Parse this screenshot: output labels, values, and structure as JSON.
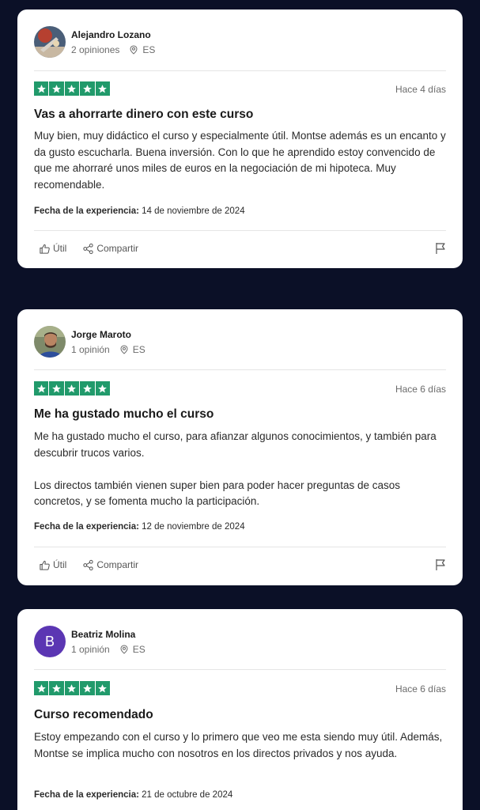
{
  "reviews": [
    {
      "reviewer": {
        "name": "Alejandro Lozano",
        "opinions": "2 opiniones",
        "country": "ES",
        "avatar": "photo-avatar"
      },
      "rating": 5,
      "date": "Hace 4 días",
      "title": "Vas a ahorrarte dinero con este curso",
      "paragraphs": [
        "Muy bien, muy didáctico el curso y especialmente útil. Montse además es un encanto y da gusto escucharla. Buena inversión. Con lo que he aprendido estoy convencido de que me ahorraré unos miles de euros en la negociación de mi hipoteca. Muy recomendable."
      ],
      "experience_label": "Fecha de la experiencia:",
      "experience_date": "14 de noviembre de 2024",
      "actions": {
        "useful": "Útil",
        "share": "Compartir"
      }
    },
    {
      "reviewer": {
        "name": "Jorge Maroto",
        "opinions": "1 opinión",
        "country": "ES",
        "avatar": "photo-avatar"
      },
      "rating": 5,
      "date": "Hace 6 días",
      "title": "Me ha gustado mucho el curso",
      "paragraphs": [
        "Me ha gustado mucho el curso, para afianzar algunos conocimientos, y también para descubrir trucos varios.",
        "Los directos también vienen super bien para poder hacer preguntas de casos concretos, y se fomenta mucho la participación."
      ],
      "experience_label": "Fecha de la experiencia:",
      "experience_date": "12 de noviembre de 2024",
      "actions": {
        "useful": "Útil",
        "share": "Compartir"
      }
    },
    {
      "reviewer": {
        "name": "Beatriz Molina",
        "opinions": "1 opinión",
        "country": "ES",
        "avatar_letter": "B"
      },
      "rating": 5,
      "date": "Hace 6 días",
      "title": "Curso recomendado",
      "paragraphs": [
        "Estoy empezando con el curso y lo primero que veo me esta siendo muy útil. Además, Montse se implica mucho con nosotros en los directos privados y nos ayuda."
      ],
      "experience_label": "Fecha de la experiencia:",
      "experience_date": "21 de octubre de 2024"
    }
  ],
  "colors": {
    "background": "#0b1027",
    "star": "#219a6b",
    "avatar_letter_bg": "#5b36b3"
  },
  "icons": [
    "location-pin-icon",
    "star-icon",
    "thumbs-up-icon",
    "share-icon",
    "flag-icon"
  ]
}
